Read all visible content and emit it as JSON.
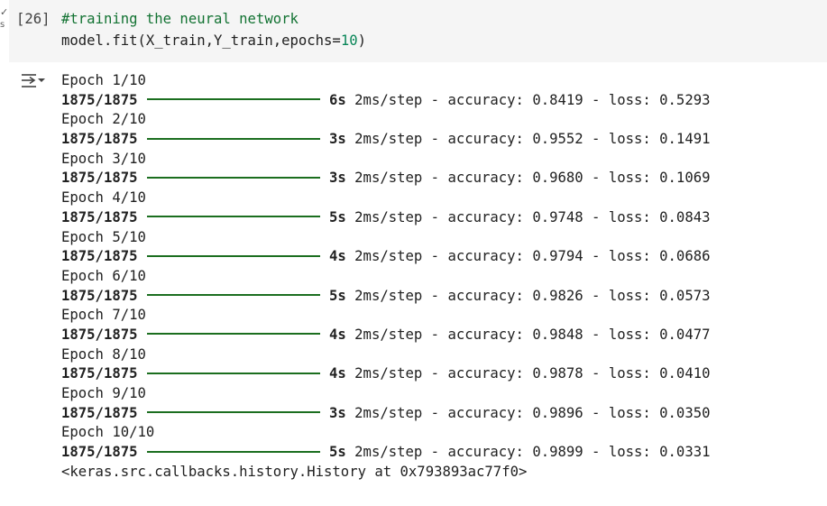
{
  "cell": {
    "execution_count": "[26]",
    "run_status_unit": "s",
    "code_comment": "#training the neural network",
    "code_call_prefix": "model.fit(X_train,Y_train,epochs=",
    "code_epochs_value": "10",
    "code_call_suffix": ")"
  },
  "output": {
    "epochs": [
      {
        "label": "Epoch 1/10",
        "steps": "1875/1875",
        "progress": 1.0,
        "time": "6s",
        "rest": "2ms/step - accuracy: 0.8419 - loss: 0.5293"
      },
      {
        "label": "Epoch 2/10",
        "steps": "1875/1875",
        "progress": 1.0,
        "time": "3s",
        "rest": "2ms/step - accuracy: 0.9552 - loss: 0.1491"
      },
      {
        "label": "Epoch 3/10",
        "steps": "1875/1875",
        "progress": 1.0,
        "time": "3s",
        "rest": "2ms/step - accuracy: 0.9680 - loss: 0.1069"
      },
      {
        "label": "Epoch 4/10",
        "steps": "1875/1875",
        "progress": 1.0,
        "time": "5s",
        "rest": "2ms/step - accuracy: 0.9748 - loss: 0.0843"
      },
      {
        "label": "Epoch 5/10",
        "steps": "1875/1875",
        "progress": 1.0,
        "time": "4s",
        "rest": "2ms/step - accuracy: 0.9794 - loss: 0.0686"
      },
      {
        "label": "Epoch 6/10",
        "steps": "1875/1875",
        "progress": 1.0,
        "time": "5s",
        "rest": "2ms/step - accuracy: 0.9826 - loss: 0.0573"
      },
      {
        "label": "Epoch 7/10",
        "steps": "1875/1875",
        "progress": 1.0,
        "time": "4s",
        "rest": "2ms/step - accuracy: 0.9848 - loss: 0.0477"
      },
      {
        "label": "Epoch 8/10",
        "steps": "1875/1875",
        "progress": 1.0,
        "time": "4s",
        "rest": "2ms/step - accuracy: 0.9878 - loss: 0.0410"
      },
      {
        "label": "Epoch 9/10",
        "steps": "1875/1875",
        "progress": 1.0,
        "time": "3s",
        "rest": "2ms/step - accuracy: 0.9896 - loss: 0.0350"
      },
      {
        "label": "Epoch 10/10",
        "steps": "1875/1875",
        "progress": 1.0,
        "time": "5s",
        "rest": "2ms/step - accuracy: 0.9899 - loss: 0.0331"
      }
    ],
    "result": "<keras.src.callbacks.history.History at 0x793893ac77f0>"
  },
  "icons": {
    "run_status": "checkmark-icon",
    "output_toggle": "output-collapse-icon"
  },
  "colors": {
    "comment": "#137333",
    "number": "#098658",
    "progress_bar": "#1b6e1f",
    "cell_background": "#f5f5f5"
  }
}
